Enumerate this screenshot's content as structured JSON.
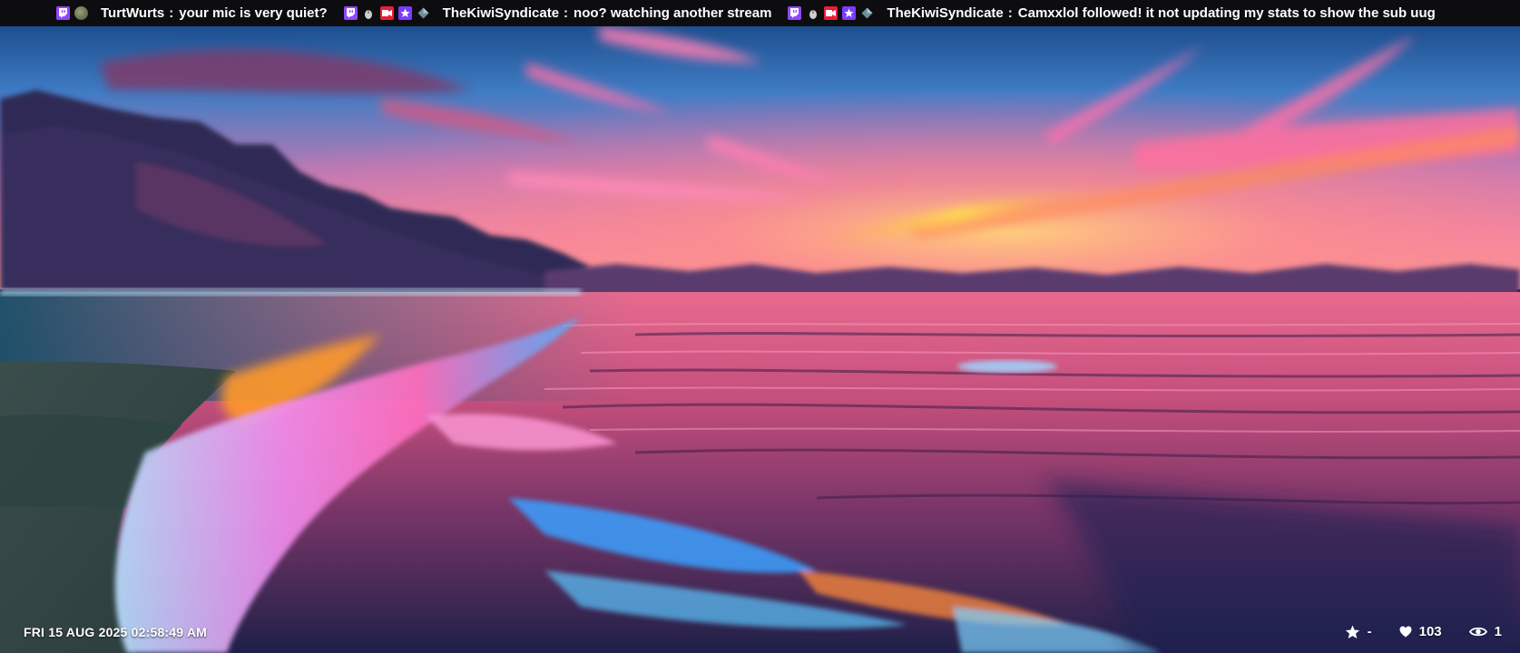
{
  "ticker": {
    "messages": [
      {
        "badges": [
          "twitch-icon",
          "moss-avatar-icon"
        ],
        "user": "TurtWurts",
        "separator": ":",
        "text": "your mic is very quiet?"
      },
      {
        "badges": [
          "twitch-icon",
          "mouse-icon",
          "video-icon",
          "prime-star-icon",
          "gem-icon"
        ],
        "user": "TheKiwiSyndicate",
        "separator": ":",
        "text": "noo?  watching another stream"
      },
      {
        "badges": [
          "twitch-icon",
          "mouse-icon",
          "video-icon",
          "prime-star-icon",
          "gem-icon"
        ],
        "user": "TheKiwiSyndicate",
        "separator": ":",
        "text": "Camxxlol followed!  it not updating my stats to show the sub uug"
      }
    ]
  },
  "clock": {
    "datetime": "FRI 15 AUG 2025 02:58:49 AM"
  },
  "stats": {
    "star_value": "-",
    "likes": "103",
    "viewers": "1"
  },
  "colors": {
    "twitch": "#9146ff",
    "ticker_bg": "#0d0d10",
    "video_badge": "#e91e3a",
    "prime_badge": "#7b3cff"
  }
}
